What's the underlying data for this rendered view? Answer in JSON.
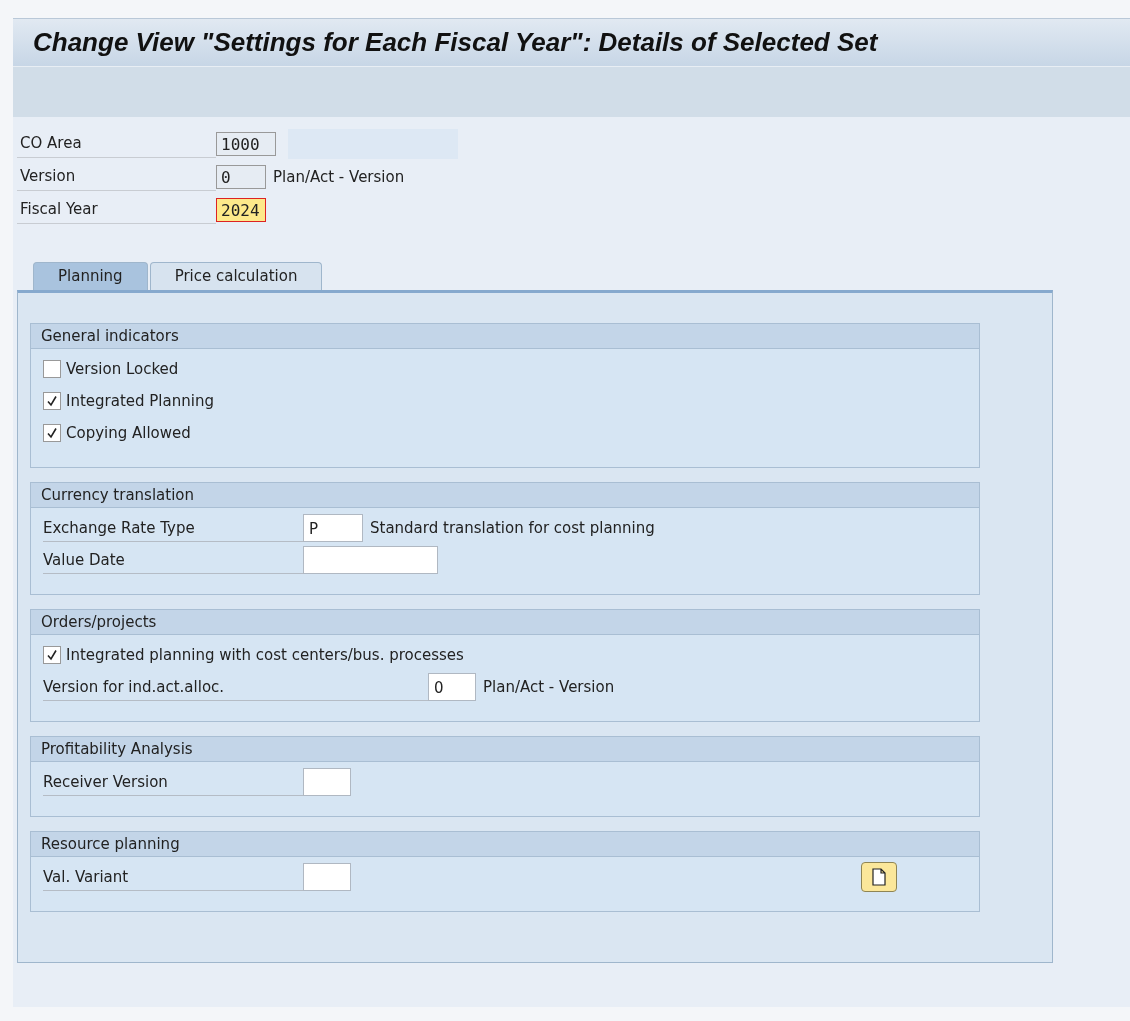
{
  "window": {
    "title": "Change View \"Settings for Each Fiscal Year\": Details of Selected Set"
  },
  "header_fields": [
    {
      "label": "CO Area",
      "value": "1000",
      "display_only": true,
      "focused": false
    },
    {
      "label": "Version",
      "value": "0",
      "display_only": true,
      "focused": false,
      "description": "Plan/Act - Version"
    },
    {
      "label": "Fiscal Year",
      "value": "2024",
      "display_only": false,
      "focused": true
    }
  ],
  "tabs": [
    {
      "label": "Planning",
      "selected": true
    },
    {
      "label": "Price calculation",
      "selected": false
    }
  ],
  "groups": [
    {
      "title": "General indicators",
      "rows": [
        {
          "kind": "checkbox",
          "label": "Version Locked",
          "checked": false
        },
        {
          "kind": "checkbox",
          "label": "Integrated Planning",
          "checked": true
        },
        {
          "kind": "checkbox",
          "label": "Copying Allowed",
          "checked": true
        }
      ]
    },
    {
      "title": "Currency translation",
      "rows": [
        {
          "kind": "field",
          "label": "Exchange Rate Type",
          "value": "P",
          "description": "Standard translation for cost planning"
        },
        {
          "kind": "datefield",
          "label": "Value Date"
        }
      ]
    },
    {
      "title": "Orders/projects",
      "wide_labels": true,
      "rows": [
        {
          "kind": "checkbox",
          "label": "Integrated planning with cost centers/bus. processes",
          "checked": true
        },
        {
          "kind": "field",
          "label": "Version for ind.act.alloc.",
          "value": "0",
          "description": "Plan/Act - Version"
        }
      ]
    },
    {
      "title": "Profitability Analysis",
      "rows": [
        {
          "kind": "field",
          "label": "Receiver Version"
        }
      ]
    },
    {
      "title": "Resource planning",
      "action_button": true,
      "rows": [
        {
          "kind": "field",
          "label": "Val. Variant"
        }
      ]
    }
  ]
}
